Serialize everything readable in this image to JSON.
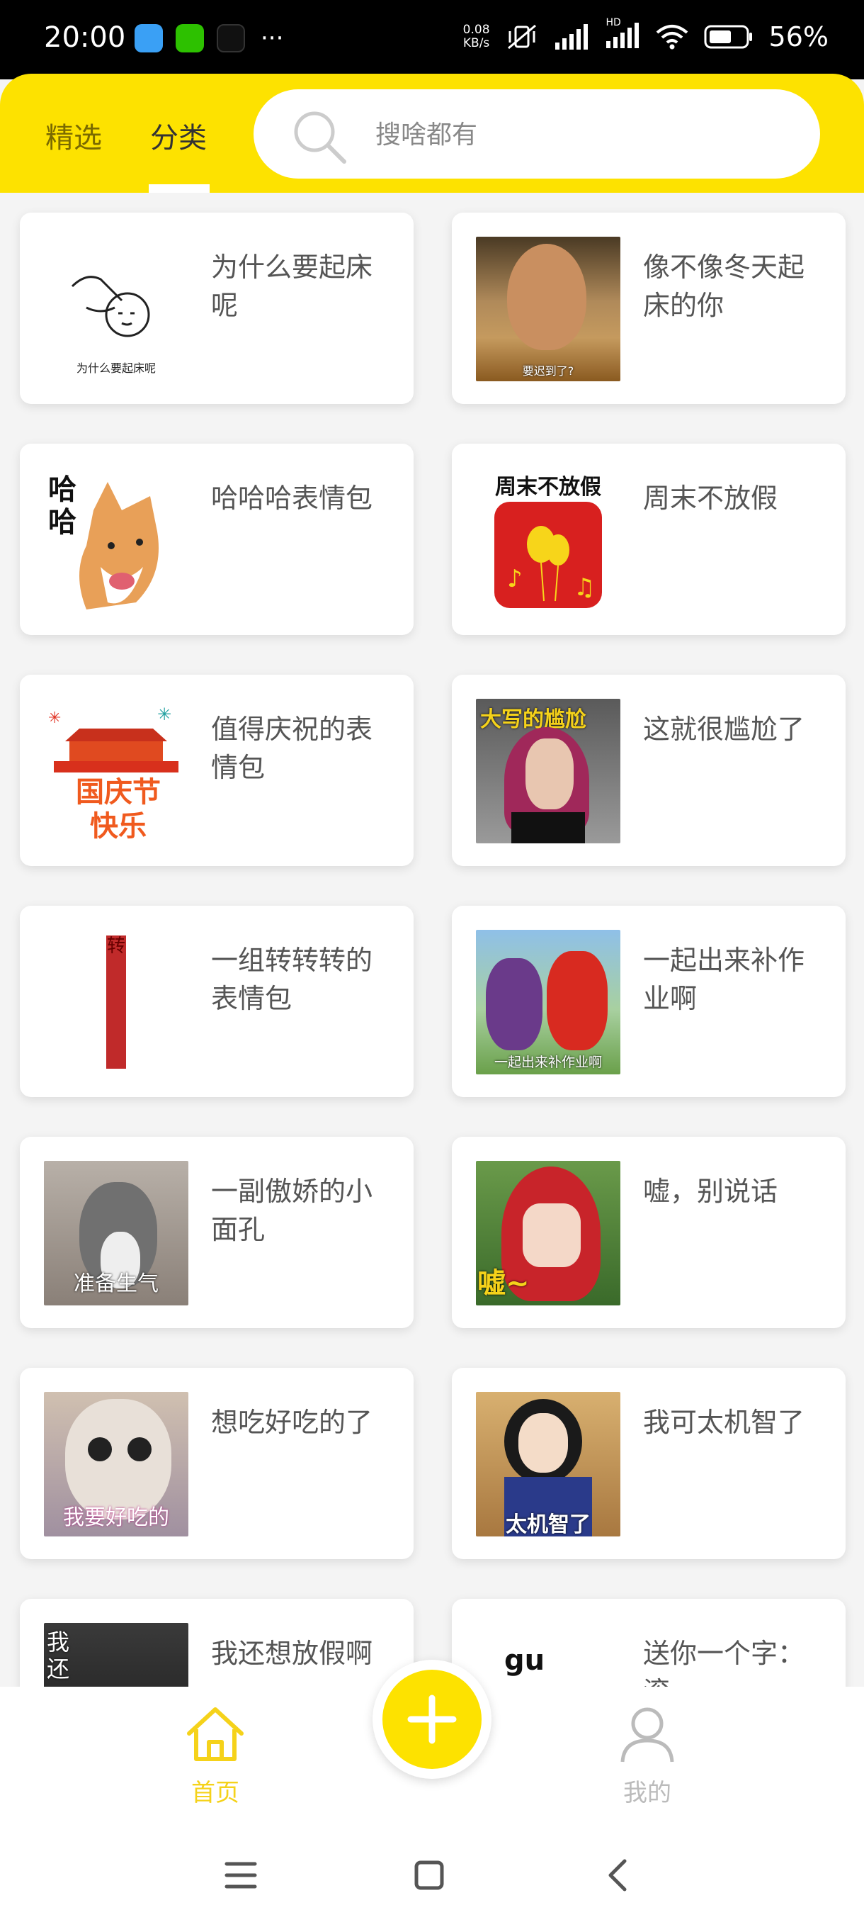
{
  "status_bar": {
    "time": "20:00",
    "net_speed_value": "0.08",
    "net_speed_unit": "KB/s",
    "hd_label": "HD",
    "battery": "56%"
  },
  "header": {
    "tabs": [
      "精选",
      "分类"
    ],
    "active_tab": "分类",
    "search_placeholder": "搜啥都有"
  },
  "cards": [
    {
      "title": "为什么要起床呢",
      "thumb_caption": "为什么要起床呢"
    },
    {
      "title": "像不像冬天起床的你",
      "thumb_caption": "要迟到了?"
    },
    {
      "title": "哈哈哈表情包",
      "thumb_caption": "哈哈"
    },
    {
      "title": "周末不放假",
      "thumb_caption": "周末不放假"
    },
    {
      "title": "值得庆祝的表情包",
      "thumb_caption": "国庆节快乐"
    },
    {
      "title": "这就很尴尬了",
      "thumb_caption": "大写的尴尬"
    },
    {
      "title": "一组转转转的表情包",
      "thumb_caption": "转"
    },
    {
      "title": "一起出来补作业啊",
      "thumb_caption": "一起出来补作业啊"
    },
    {
      "title": "一副傲娇的小面孔",
      "thumb_caption": "准备生气"
    },
    {
      "title": "嘘，别说话",
      "thumb_caption": "嘘~"
    },
    {
      "title": "想吃好吃的了",
      "thumb_caption": "我要好吃的"
    },
    {
      "title": "我可太机智了",
      "thumb_caption": "太机智了"
    },
    {
      "title": "我还想放假啊",
      "thumb_caption": "我还"
    },
    {
      "title": "送你一个字：滚",
      "thumb_caption": "gu"
    }
  ],
  "bottom_nav": {
    "home_label": "首页",
    "me_label": "我的"
  },
  "colors": {
    "accent_yellow": "#fde200",
    "active_nav": "#f5d21a",
    "inactive_nav": "#bbbbbb",
    "status_bar_bg": "#000000"
  }
}
